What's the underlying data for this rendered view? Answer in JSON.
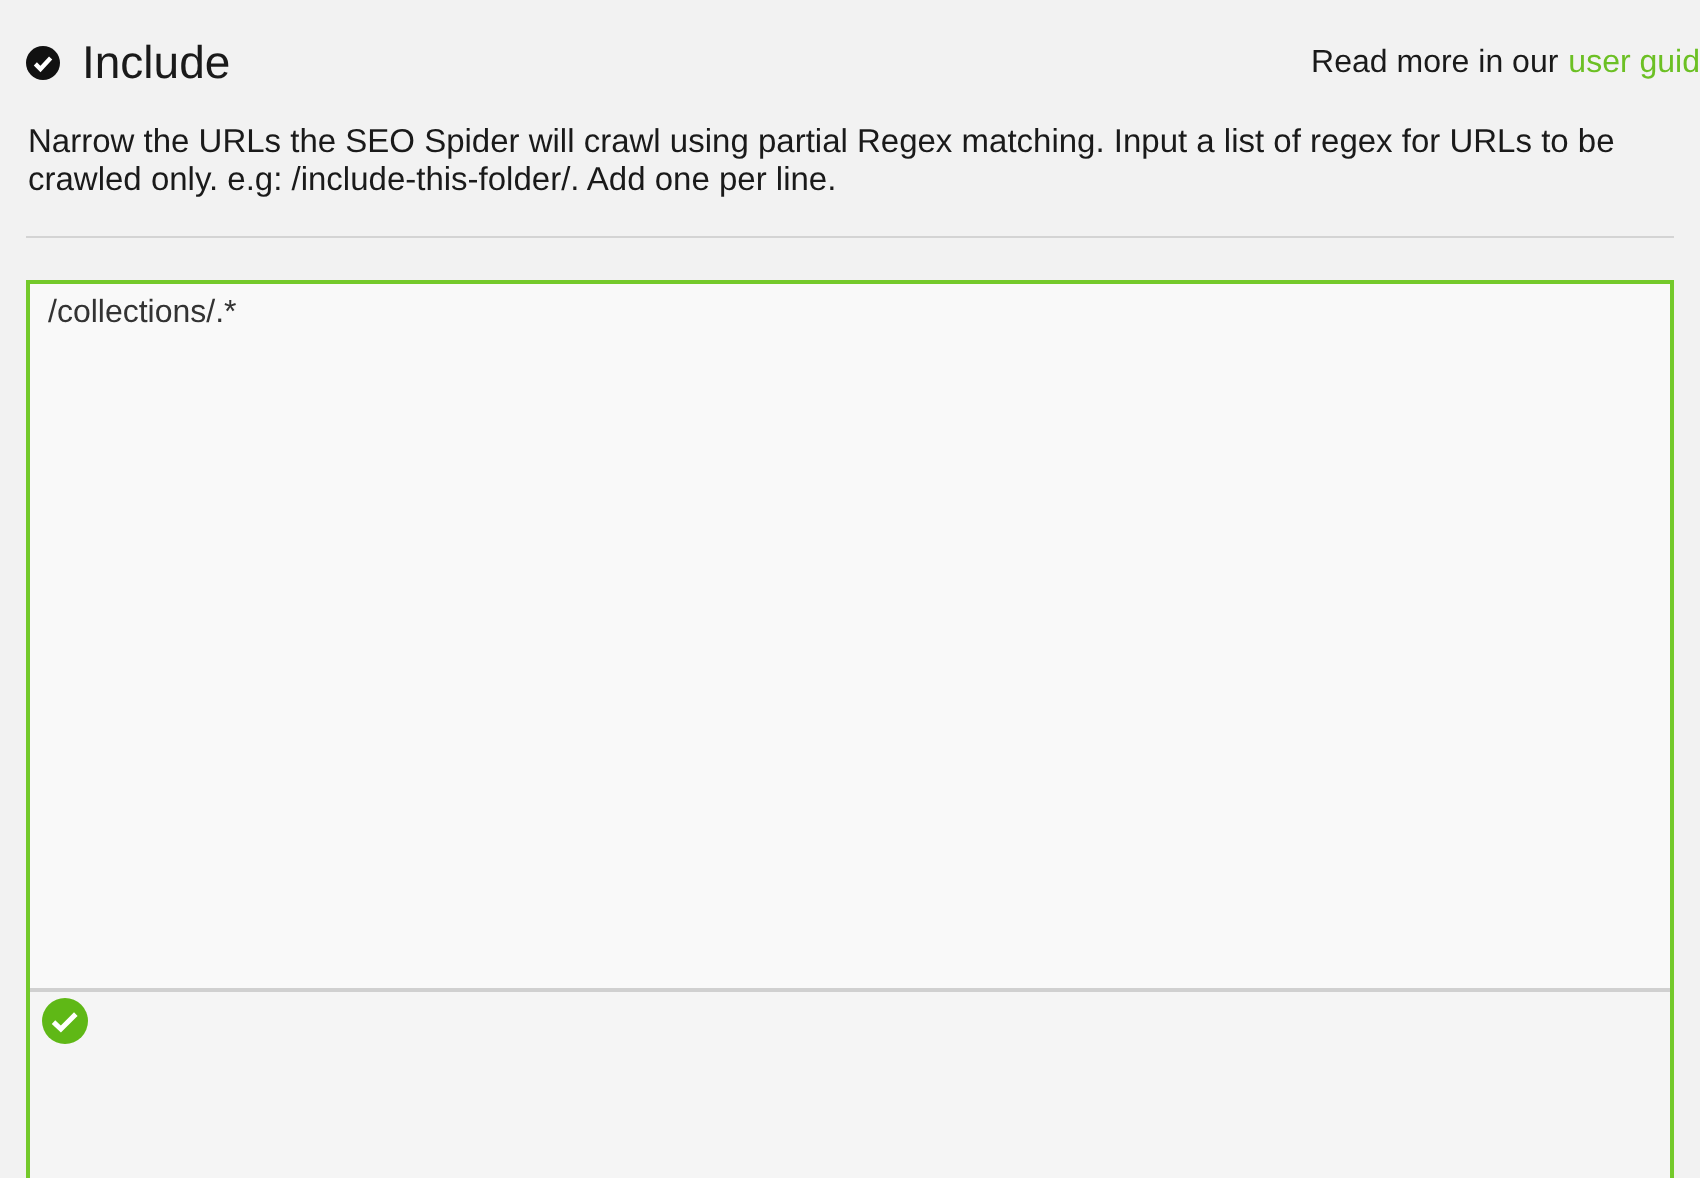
{
  "header": {
    "title": "Include",
    "checked": true,
    "help_text": "Read more in our",
    "help_link": "user guid"
  },
  "description": "Narrow the URLs the SEO Spider will crawl using partial Regex matching. Input a list of regex for URLs to be crawled only. e.g: /include-this-folder/. Add one per line.",
  "editor": {
    "value": "/collections/.*",
    "valid": true
  }
}
